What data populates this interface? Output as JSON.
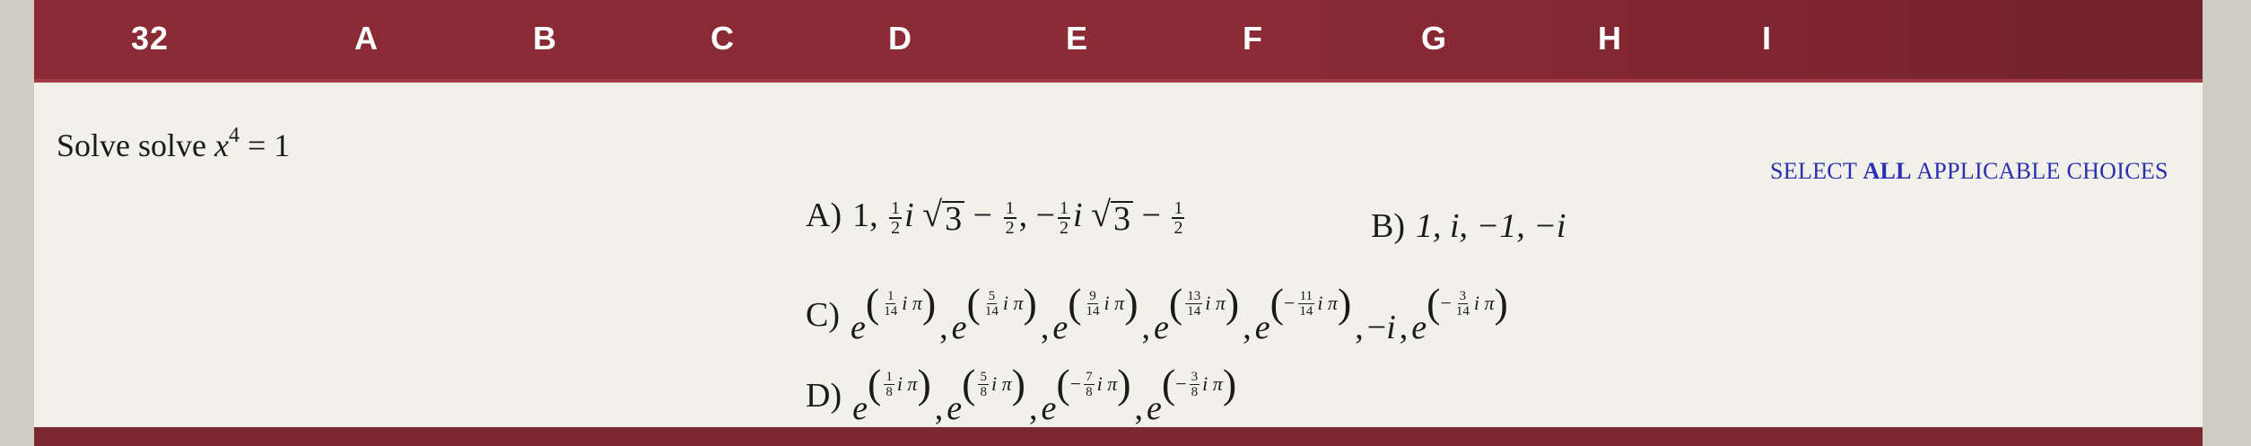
{
  "header": {
    "columns": [
      "32",
      "A",
      "B",
      "C",
      "D",
      "E",
      "F",
      "G",
      "H",
      "I"
    ]
  },
  "question": {
    "prefix": "Solve solve ",
    "variable": "x",
    "power": "4",
    "rhs": " = 1"
  },
  "instruction": {
    "pre": "SELECT ",
    "bold": "ALL",
    "post": " APPLICABLE CHOICES"
  },
  "choices": {
    "a": {
      "label": "A)"
    },
    "b": {
      "label": "B)",
      "text": "1, i, −1, −i"
    },
    "c": {
      "label": "C)"
    },
    "d": {
      "label": "D)"
    }
  },
  "colors": {
    "header": "#8a2a34",
    "background": "#f1f0e9",
    "instruction": "#2a2fb0"
  }
}
